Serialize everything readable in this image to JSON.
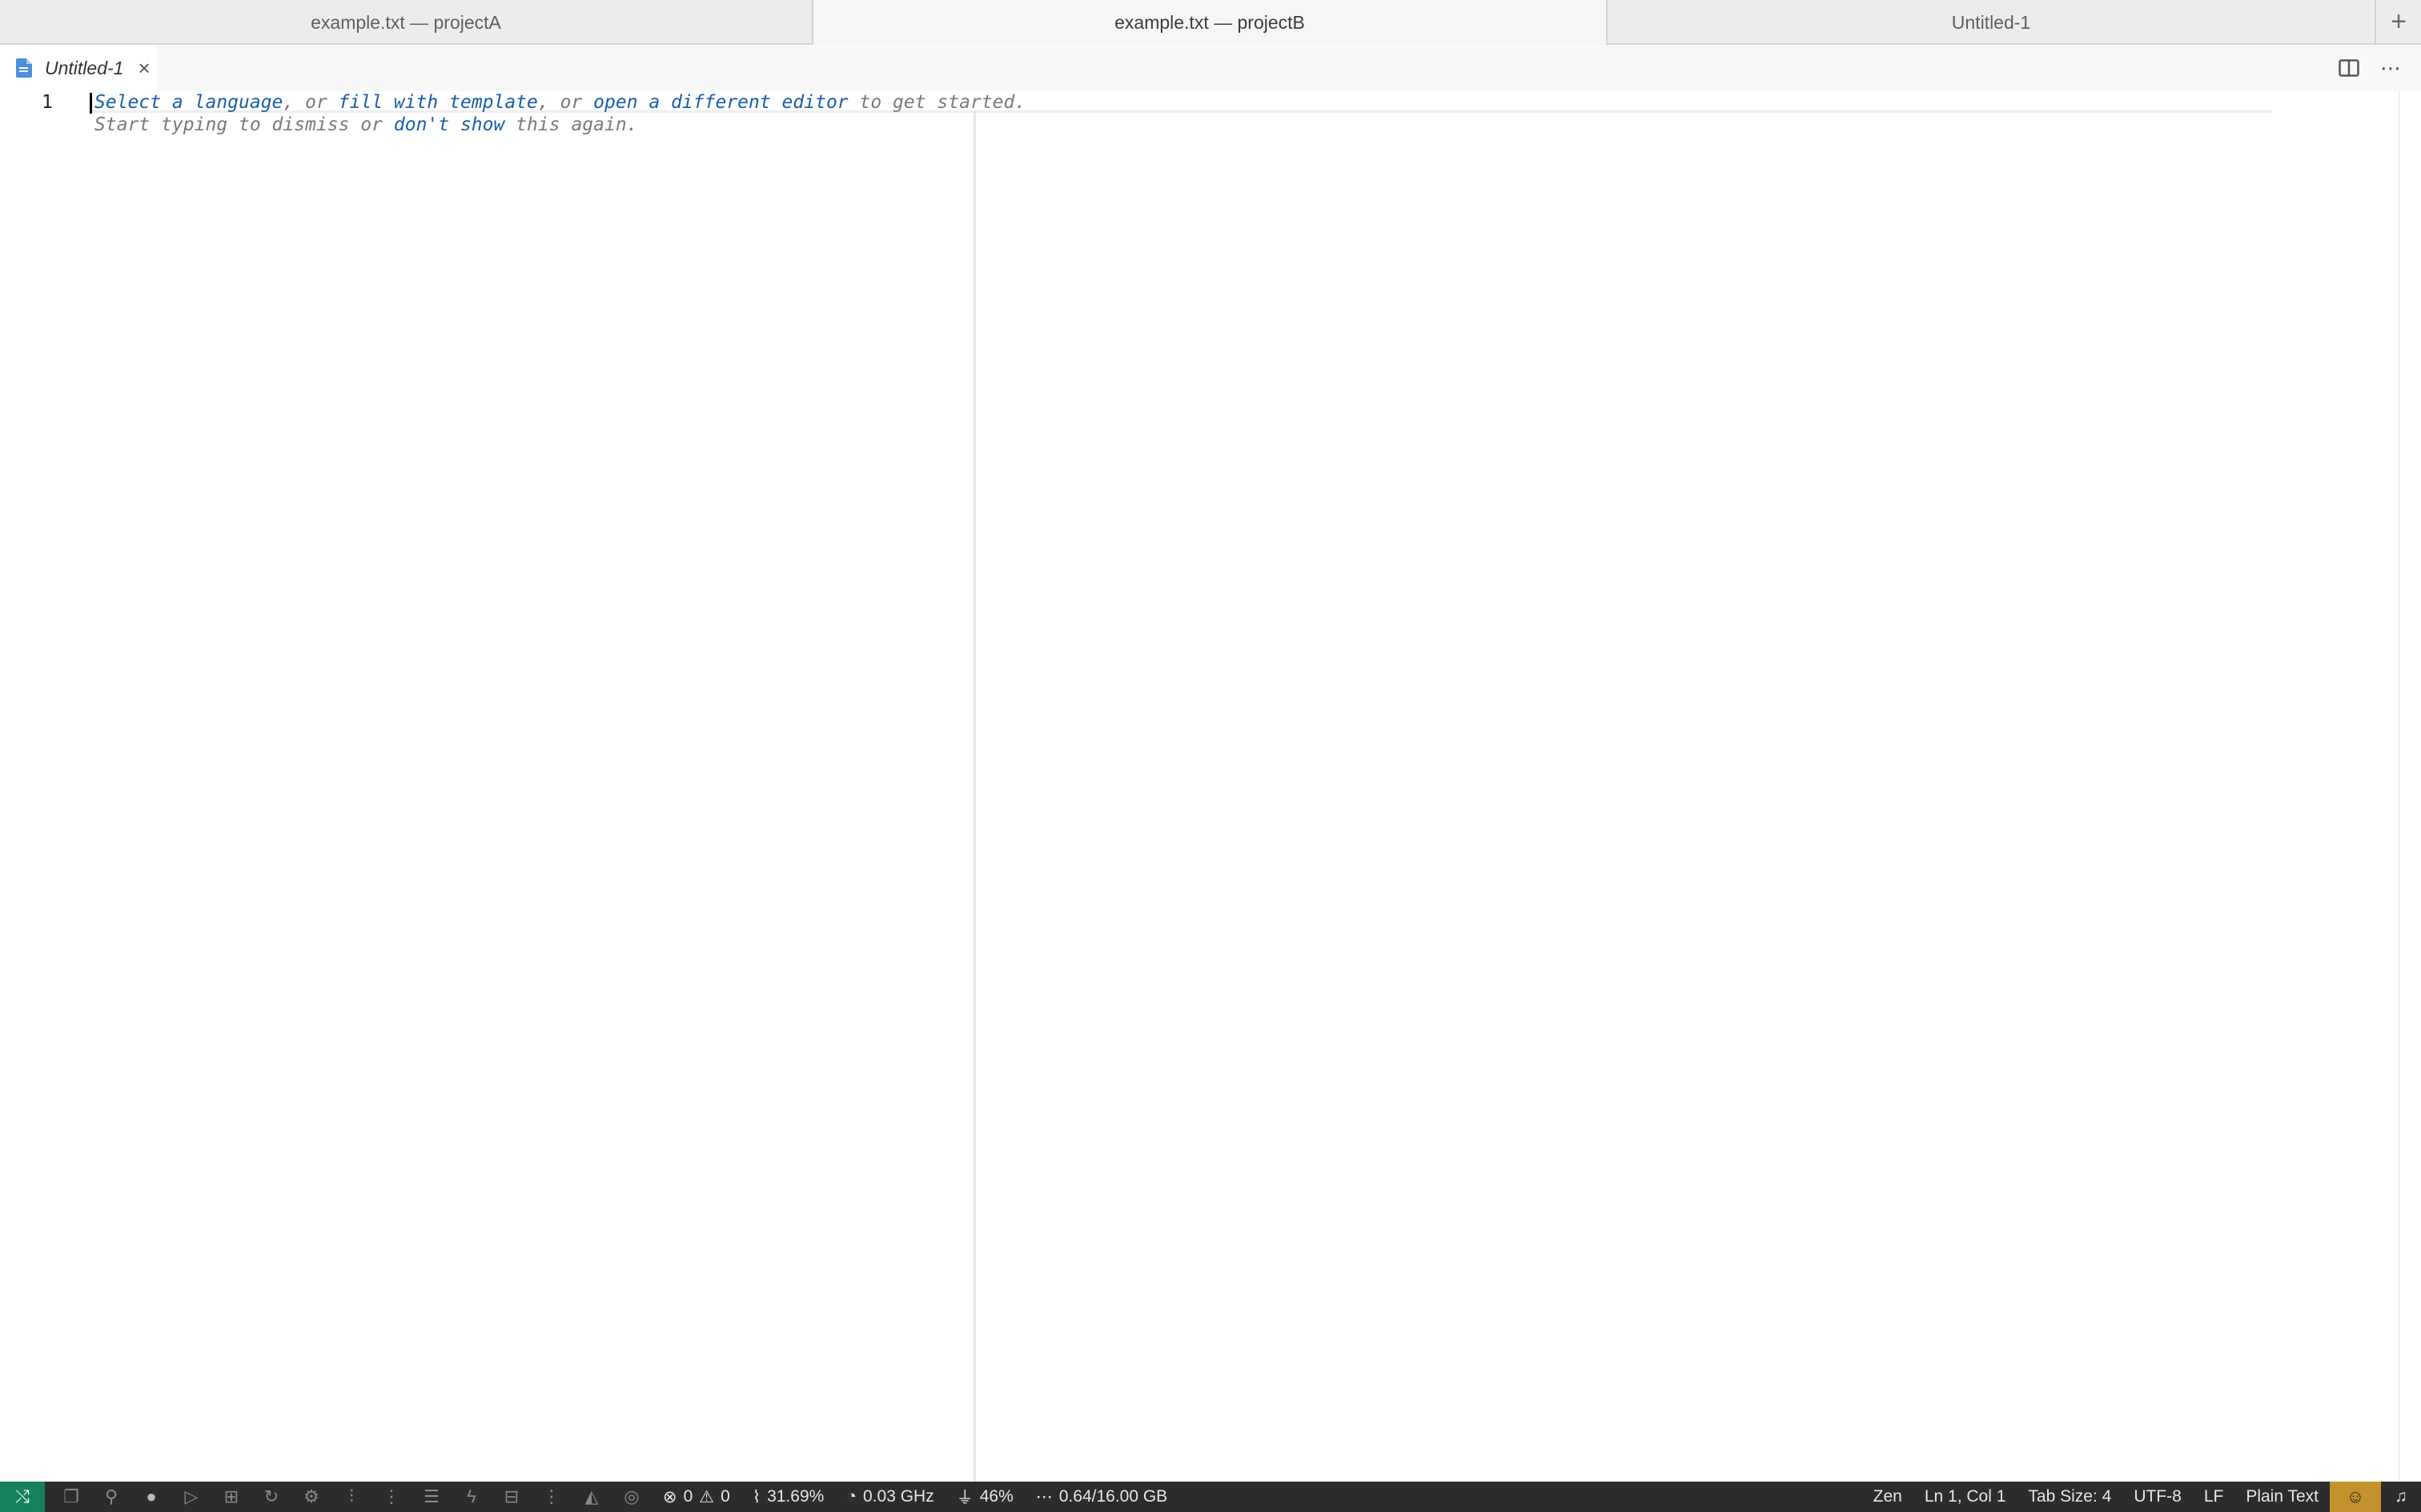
{
  "window_tabs": [
    {
      "label": "example.txt — projectA"
    },
    {
      "label": "example.txt — projectB"
    },
    {
      "label": "Untitled-1"
    }
  ],
  "editor_tab": {
    "label": "Untitled-1",
    "close": "×"
  },
  "editor": {
    "line_number": "1",
    "hint_line1": {
      "link1": "Select a language",
      "sep1": ", or ",
      "link2": "fill with template",
      "sep2": ", or ",
      "link3": "open a different editor",
      "tail": " to get started."
    },
    "hint_line2": {
      "text1": "Start typing to dismiss or ",
      "link": "don't show",
      "tail": " this again."
    }
  },
  "status_bar": {
    "problems": {
      "errors": "0",
      "warnings": "0"
    },
    "cpu": "31.69%",
    "freq": "0.03 GHz",
    "battery": "46%",
    "memory": "0.64/16.00 GB",
    "zen": "Zen",
    "position": "Ln 1, Col 1",
    "tab_size": "Tab Size: 4",
    "encoding": "UTF-8",
    "eol": "LF",
    "language": "Plain Text"
  },
  "icons": {
    "remote": "remote-icon",
    "status_icons": [
      "explorer-icon",
      "search-icon",
      "github-icon",
      "run-icon",
      "extensions-icon",
      "sync-icon",
      "gear-icon",
      "sliders-icon",
      "more-icon",
      "layers-icon",
      "plug-icon",
      "car-icon",
      "more-icon",
      "triangle-icon",
      "account-icon"
    ]
  }
}
